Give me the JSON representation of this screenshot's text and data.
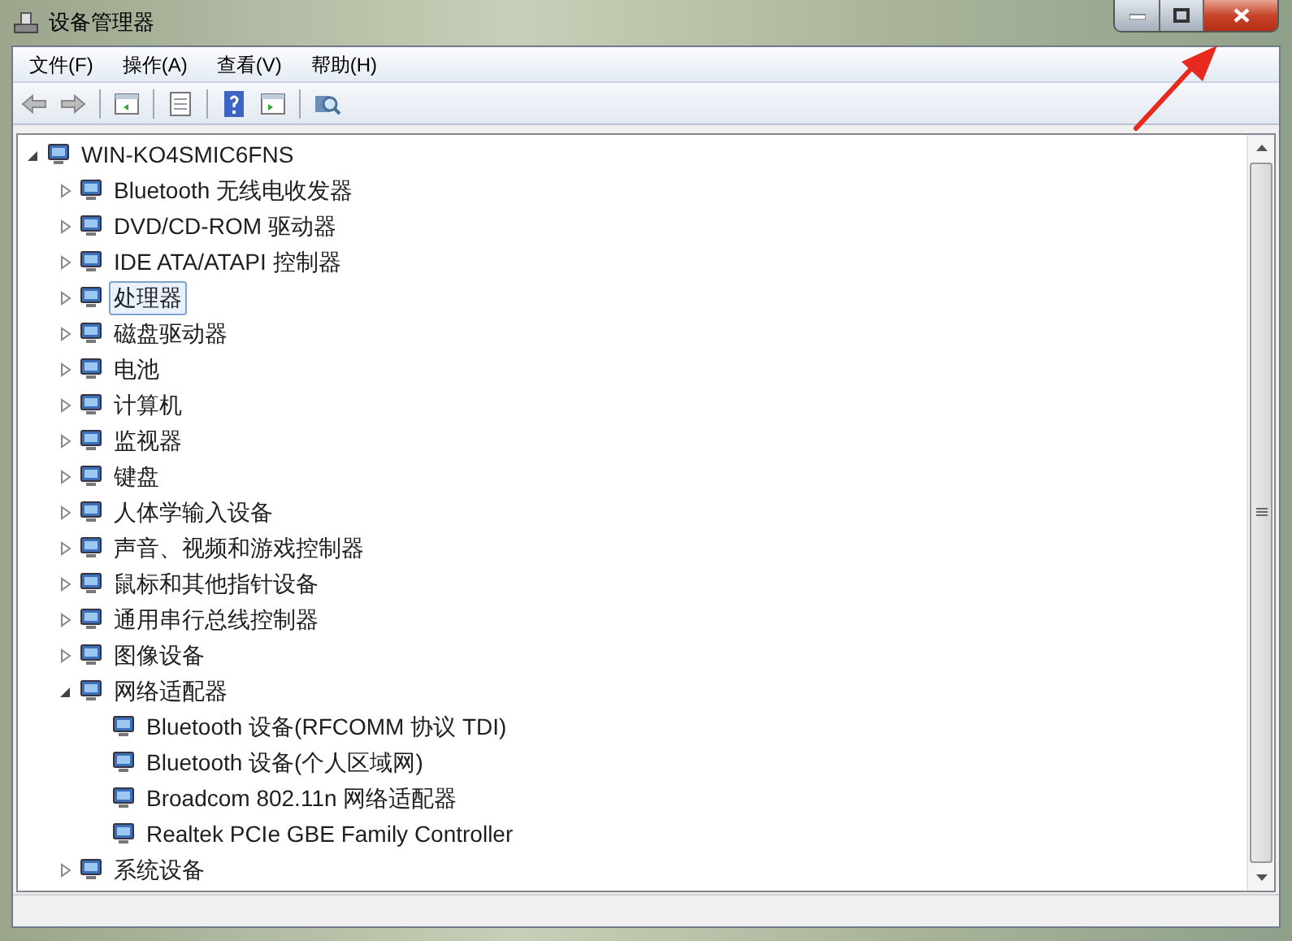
{
  "window": {
    "title": "设备管理器"
  },
  "menu": [
    "文件(F)",
    "操作(A)",
    "查看(V)",
    "帮助(H)"
  ],
  "tree": {
    "label": "WIN-KO4SMIC6FNS",
    "expanded": true,
    "selected": false,
    "children": [
      {
        "label": "Bluetooth 无线电收发器",
        "expanded": false,
        "selected": false
      },
      {
        "label": "DVD/CD-ROM 驱动器",
        "expanded": false,
        "selected": false
      },
      {
        "label": "IDE ATA/ATAPI 控制器",
        "expanded": false,
        "selected": false
      },
      {
        "label": "处理器",
        "expanded": false,
        "selected": true
      },
      {
        "label": "磁盘驱动器",
        "expanded": false,
        "selected": false
      },
      {
        "label": "电池",
        "expanded": false,
        "selected": false
      },
      {
        "label": "计算机",
        "expanded": false,
        "selected": false
      },
      {
        "label": "监视器",
        "expanded": false,
        "selected": false
      },
      {
        "label": "键盘",
        "expanded": false,
        "selected": false
      },
      {
        "label": "人体学输入设备",
        "expanded": false,
        "selected": false
      },
      {
        "label": "声音、视频和游戏控制器",
        "expanded": false,
        "selected": false
      },
      {
        "label": "鼠标和其他指针设备",
        "expanded": false,
        "selected": false
      },
      {
        "label": "通用串行总线控制器",
        "expanded": false,
        "selected": false
      },
      {
        "label": "图像设备",
        "expanded": false,
        "selected": false
      },
      {
        "label": "网络适配器",
        "expanded": true,
        "selected": false,
        "children": [
          {
            "label": "Bluetooth 设备(RFCOMM 协议 TDI)",
            "selected": false
          },
          {
            "label": "Bluetooth 设备(个人区域网)",
            "selected": false
          },
          {
            "label": "Broadcom 802.11n 网络适配器",
            "selected": false
          },
          {
            "label": "Realtek PCIe GBE Family Controller",
            "selected": false
          }
        ]
      },
      {
        "label": "系统设备",
        "expanded": false,
        "selected": false
      }
    ]
  }
}
